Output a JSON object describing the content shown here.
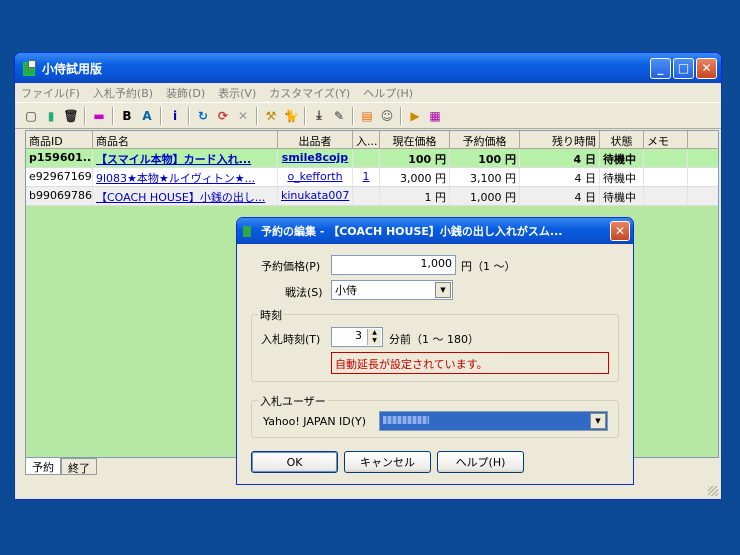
{
  "window": {
    "title": "小侍試用版"
  },
  "menu": [
    "ファイル(F)",
    "入札予約(B)",
    "装飾(D)",
    "表示(V)",
    "カスタマイズ(Y)",
    "ヘルプ(H)"
  ],
  "columns": [
    "商品ID",
    "商品名",
    "出品者",
    "入...",
    "現在価格",
    "予約価格",
    "残り時間",
    "状態",
    "メモ"
  ],
  "rows": [
    {
      "id": "p159601...",
      "name": "【スマイル本物】カード入れ...",
      "seller": "smile8cojp",
      "bids": "",
      "current": "100 円",
      "reserve": "100 円",
      "remaining": "4 日",
      "status": "待機中",
      "memo": ""
    },
    {
      "id": "e92967169",
      "name": "9l083★本物★ルイヴィトン★...",
      "seller": "o_kefforth",
      "bids": "1",
      "current": "3,000 円",
      "reserve": "3,100 円",
      "remaining": "4 日",
      "status": "待機中",
      "memo": ""
    },
    {
      "id": "b99069786",
      "name": "【COACH HOUSE】小銭の出し...",
      "seller": "kinukata007",
      "bids": "",
      "current": "1 円",
      "reserve": "1,000 円",
      "remaining": "4 日",
      "status": "待機中",
      "memo": ""
    }
  ],
  "tabs": [
    "予約",
    "終了"
  ],
  "dialog": {
    "title": "予約の編集 - 【COACH HOUSE】小銭の出し入れがスム...",
    "price_label": "予約価格(P)",
    "price_value": "1,000",
    "price_unit": "円（1 ～）",
    "tactic_label": "戦法(S)",
    "tactic_value": "小侍",
    "time_group": "時刻",
    "bidtime_label": "入札時刻(T)",
    "bidtime_value": "3",
    "bidtime_unit": "分前（1 ～ 180）",
    "warning": "自動延長が設定されています。",
    "user_group": "入札ユーザー",
    "yahoo_label": "Yahoo! JAPAN ID(Y)",
    "ok": "OK",
    "cancel": "キャンセル",
    "help": "ヘルプ(H)"
  },
  "colors": {
    "title_blue": "#0a5fe0",
    "desktop": "#0d4a96",
    "list_bg": "#b7e8a3",
    "warning_border": "#c00000",
    "warning_text": "#c00000"
  }
}
